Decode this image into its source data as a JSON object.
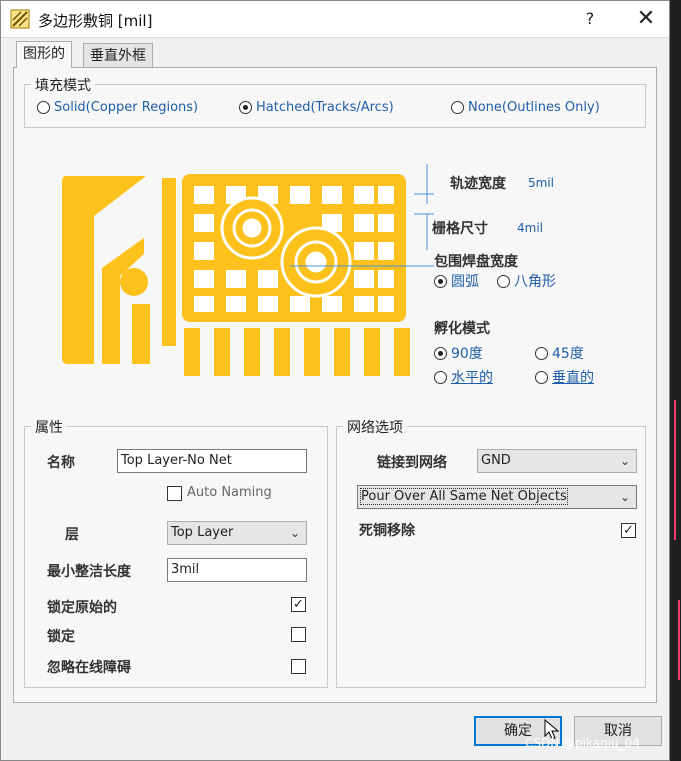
{
  "window": {
    "title": "多边形敷铜 [mil]",
    "help": "?",
    "close": "✕"
  },
  "tabs": [
    "图形的",
    "垂直外框"
  ],
  "fill_mode": {
    "title": "填充模式",
    "options": [
      "Solid(Copper Regions)",
      "Hatched(Tracks/Arcs)",
      "None(Outlines Only)"
    ],
    "selected": 1
  },
  "preview": {
    "track_width_label": "轨迹宽度",
    "track_width_value": "5mil",
    "grid_size_label": "栅格尺寸",
    "grid_size_value": "4mil",
    "surround_label": "包围焊盘宽度",
    "surround_options": [
      "圆弧",
      "八角形"
    ],
    "surround_selected": 0,
    "hatch_label": "孵化模式",
    "hatch_options": [
      "90度",
      "45度",
      "水平的",
      "垂直的"
    ],
    "hatch_selected": 0,
    "copper_color": "#fcc21b"
  },
  "properties": {
    "title": "属性",
    "name_label": "名称",
    "name_value": "Top Layer-No Net",
    "auto_naming": "Auto Naming",
    "layer_label": "层",
    "layer_value": "Top Layer",
    "min_len_label": "最小整洁长度",
    "min_len_value": "3mil",
    "lock_primitives": "锁定原始的",
    "lock_primitives_checked": true,
    "locked": "锁定",
    "locked_checked": false,
    "ignore_online": "忽略在线障碍",
    "ignore_online_checked": false
  },
  "net_options": {
    "title": "网络选项",
    "connect_label": "链接到网络",
    "connect_value": "GND",
    "pour_value": "Pour Over All Same Net Objects",
    "remove_dead": "死铜移除",
    "remove_dead_checked": true
  },
  "buttons": {
    "ok": "确定",
    "cancel": "取消"
  },
  "watermark": "CSDN @pikaqiu_04"
}
